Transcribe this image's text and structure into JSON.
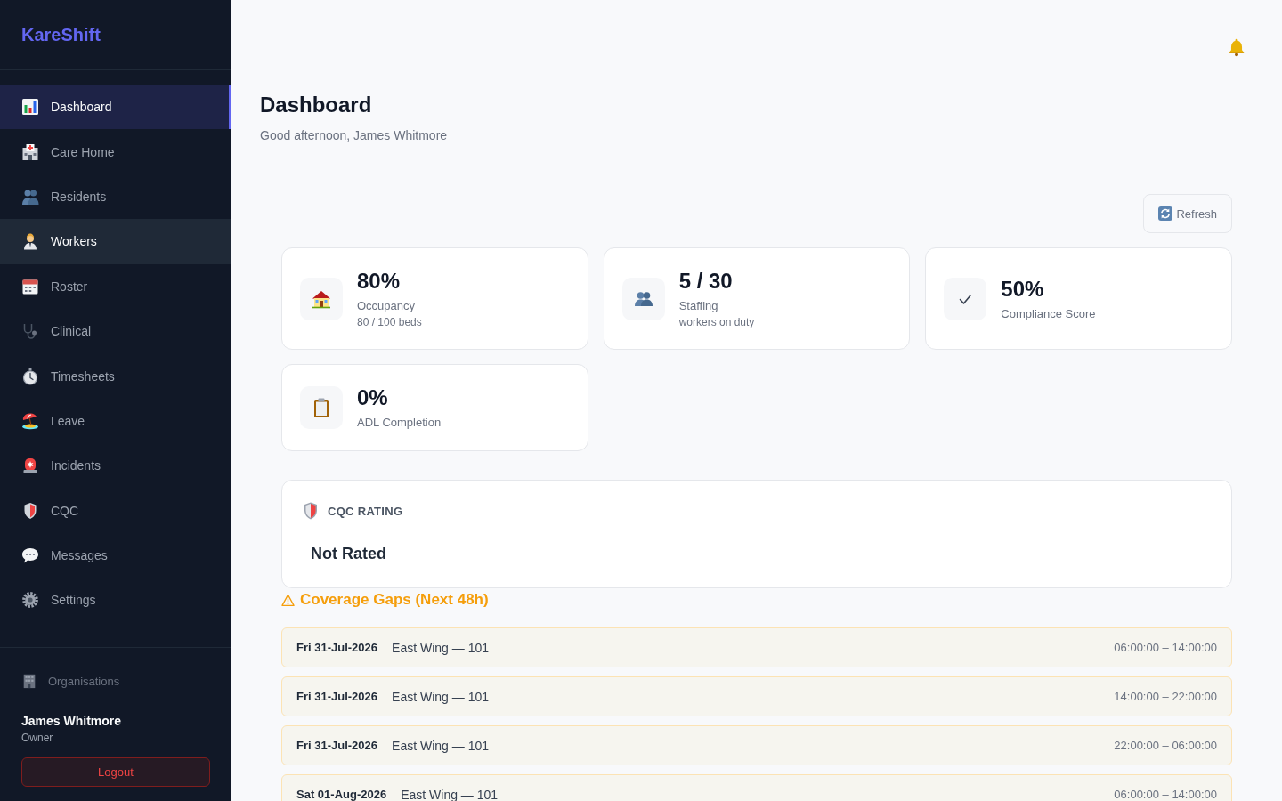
{
  "sidebar": {
    "logo": "KareShift",
    "nav_items": [
      {
        "label": "Dashboard",
        "selected": true,
        "hovered": false
      },
      {
        "label": "Care Home",
        "selected": false,
        "hovered": false
      },
      {
        "label": "Residents",
        "selected": false,
        "hovered": false
      },
      {
        "label": "Workers",
        "selected": false,
        "hovered": true
      },
      {
        "label": "Roster",
        "selected": false,
        "hovered": false
      },
      {
        "label": "Clinical",
        "selected": false,
        "hovered": false
      },
      {
        "label": "Timesheets",
        "selected": false,
        "hovered": false
      },
      {
        "label": "Leave",
        "selected": false,
        "hovered": false
      },
      {
        "label": "Incidents",
        "selected": false,
        "hovered": false
      },
      {
        "label": "CQC",
        "selected": false,
        "hovered": false
      },
      {
        "label": "Messages",
        "selected": false,
        "hovered": false
      },
      {
        "label": "Settings",
        "selected": false,
        "hovered": false
      }
    ],
    "organisations_link": "Organisations",
    "user": {
      "name": "James Whitmore",
      "role": "Owner"
    },
    "logout_button": "Logout"
  },
  "header": {
    "title": "Dashboard",
    "greeting": "Good afternoon, James Whitmore"
  },
  "refresh_button": "Refresh",
  "stats": [
    {
      "value": "80%",
      "label": "Occupancy",
      "detail": "80 / 100 beds"
    },
    {
      "value": "5 / 30",
      "label": "Staffing",
      "detail": "workers on duty"
    },
    {
      "value": "50%",
      "label": "Compliance Score"
    },
    {
      "value": "0%",
      "label": "ADL Completion"
    }
  ],
  "cqc_rating": {
    "heading": "CQC RATING",
    "value": "Not Rated"
  },
  "coverage_gaps": {
    "title": "Coverage Gaps (Next 48h)",
    "shifts": [
      {
        "date": "Fri 31-Jul-2026",
        "location": "East Wing — 101",
        "time": "06:00:00 – 14:00:00"
      },
      {
        "date": "Fri 31-Jul-2026",
        "location": "East Wing — 101",
        "time": "14:00:00 – 22:00:00"
      },
      {
        "date": "Fri 31-Jul-2026",
        "location": "East Wing — 101",
        "time": "22:00:00 – 06:00:00"
      },
      {
        "date": "Sat 01-Aug-2026",
        "location": "East Wing — 101",
        "time": "06:00:00 – 14:00:00"
      }
    ]
  }
}
